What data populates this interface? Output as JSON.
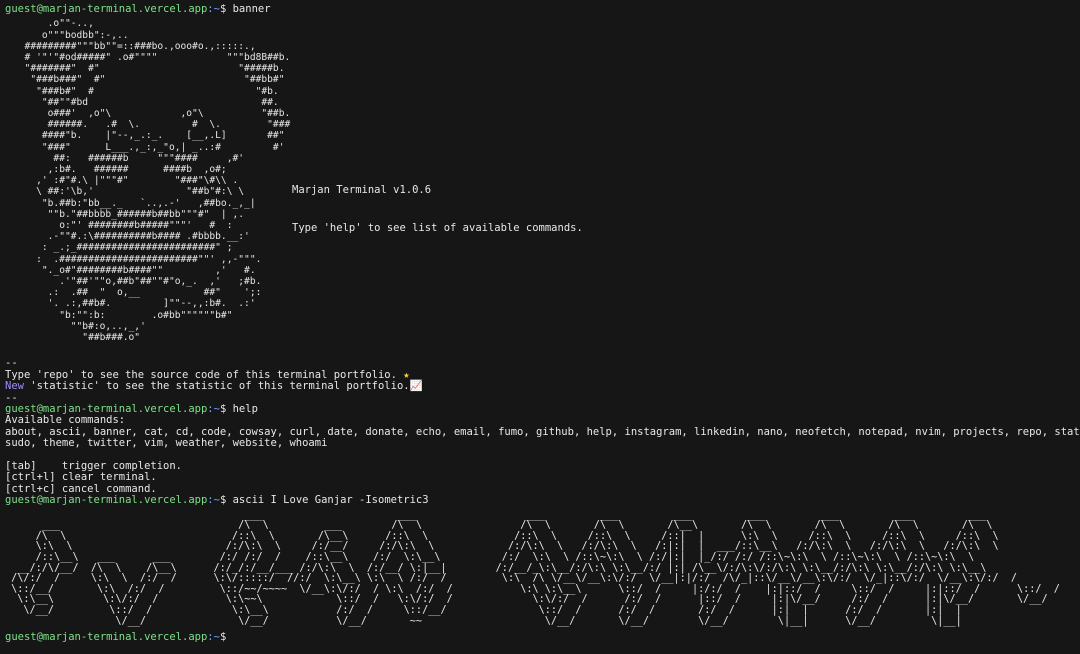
{
  "prompt": {
    "user_host": "guest@marjan-terminal.vercel.app",
    "path": ":~",
    "symbol": "$"
  },
  "commands": {
    "banner": "banner",
    "help": "help",
    "ascii": "ascii I Love Ganjar -Isometric3",
    "current": ""
  },
  "banner": {
    "ascii_art": "      .o\"\"-..,\n     o\"\"\"bodbb\":-,..\n  #########\"\"\"bb\"\"=::###bo.,ooo#o.,:::::.,\n  # '\"'\"#od#####\" .o#\"\"\"\"            \"\"\"bd8B##b.\n  \"#######\"  #\"                        \"#####b.\n   \"###b###\"  #\"                        \"##bb#\"\n    \"###b#\"  #                            \"#b.\n     \"##\"\"#bd                              ##.\n      o###'  ,o\"\\            ,o\"\\          \"##b.\n      ######.   .#  \\.         #  \\.        \"###\n     ####\"b.    |\"--,_.:_.    [__,.L]       ##\"\n     \"###\"      L___.,_:,_\"o,| _..:#         #'\n       ##:   ######b     \"\"\"####     ,#'\n      ,:b#.   ######      ####b  ,o#;\n    ,' :#\"#.\\ |\"\"\"#\"        \"###\"\\#\\\\ .\n    \\ ##:'\\b,'                \"##b\"#:\\ \\\n     \"b.##b:\"bb__._   `..,.-'   ,##bo._,_|\n      \"\"b.\"##bbbb_######b##bb\"\"\"#\"  | ,.\n        o:\"' ########b#####\"\"\"'   #  :\n      .-\"\"#.:\\##########b#### .#bbbb.__:'\n     : _.;_########################\" ;\n    :  .########################\"\"' ,,-\"\"\".\n     \"._o#\"########b####\"\"         ,'   #.\n        .'\"##'\"\"o,##b\"##\"\"#\"o,_.  ,'   ;#b.\n      .:  .##  \"  o,__           ##\"    ';:\n      '. .:,##b#.         ]\"\"--,,:b#.  .:'\n        \"b:\"\":b:        .o#bb\"\"\"\"\"\"b#\"\n          \"\"b#:o,..,_,'\n            \"##b###.o\"",
    "title": "Marjan Terminal v1.0.6",
    "hint": "Type 'help' to see list of available commands."
  },
  "messages": {
    "separator_top": "--",
    "repo_line": "Type 'repo' to see the source code of this terminal portfolio.",
    "repo_emoji": "★",
    "new_label": "New",
    "statistic_line": " 'statistic' to see the statistic of this terminal portfolio.",
    "statistic_emoji": "📈",
    "separator_bottom": "--"
  },
  "help": {
    "header": "Available commands:",
    "commands_line1": "about, ascii, banner, cat, cd, code, cowsay, curl, date, donate, echo, email, fumo, github, help, instagram, linkedin, nano, neofetch, notepad, nvim, projects, repo, statistic,",
    "commands_line2": "sudo, theme, twitter, vim, weather, website, whoami",
    "shortcut_tab": "[tab]    trigger completion.",
    "shortcut_clear": "[ctrl+l] clear terminal.",
    "shortcut_cancel": "[ctrl+c] cancel command."
  },
  "ascii_output": {
    "art": "                                       ___                      ___                  ___         ___         ___         ___         ___         ___         ___\n      ___                             /\\  \\         ___        /\\  \\                /\\  \\       /\\  \\       /\\__\\       /\\  \\       /\\  \\       /\\  \\       /\\  \\\n     /\\  \\                           /::\\  \\       /\\__\\      /::\\  \\              /::\\  \\     /::\\  \\     /::|  |      \\:\\  \\     /::\\  \\     /::\\  \\     /::\\  \\\n     \\:\\  \\                         /:/\\:\\  \\     /:/__/     /:/\\:\\  \\            /:/\\:\\  \\   /:/\\:\\  \\   /:|:|  |  ___/::\\__\\   /:/\\:\\  \\   /:/\\:\\  \\   /:/\\:\\  \\\n     /::\\__\\   ___      ___        /:/ /:/  /    /::\\__\\    /:/  \\:\\__\\          /:/  \\:\\  \\ /::\\~\\:\\  \\ /:/|:|  |_/:/ /:/ /::\\~\\:\\  \\ /::\\~\\:\\  \\ /::\\~\\:\\  \\\n  __/:/\\/__/  /\\  \\    /\\__\\      /:/_/:/__/___ /:/\\:\\  \\  /:/__/ \\:|__|        /:/__/_\\:\\__/:/\\:\\ \\:\\__/:/ |:| /\\__\\/:/\\:\\/:/\\:\\ \\:\\__/:/\\:\\ \\:\\__/:/\\:\\ \\:\\__\\\n /\\/:/  /     \\:\\  \\  /:/  /      \\:\\/:::::/  //:/  \\:\\__\\ \\:\\  \\ /:/  /         \\:\\  /\\ \\/__\\/__\\:\\/:/  \\/__|:|/:/  /\\/_|::\\/__\\/__\\:\\/:/  \\/_|::\\/:/  \\/__\\:\\/:/  /\n \\::/__/       \\:\\  /:/  /         \\::/~~/~~~~  \\/__\\:\\/:/  / \\:\\  /:/  /           \\:\\ \\:\\__\\      \\::/  /     |:/:/  /    |:|::/  /     \\::/  /     |:|::/  /      \\::/  /\n  \\:\\__\\        \\:\\/:/  /           \\:\\~~\\            \\::/  /   \\:\\/:/  /             \\:\\/:/  /      /:/  /      |::/  /     |:|\\/__/     /:/  /      |:|\\/__/       \\/__/\n   \\/__/         \\::/  /             \\:\\__\\           /:/  /     \\::/__/               \\::/  /      /:/  /       /:/  /      |:|  |      /:/  /       |:|  |\n                  \\/__/               \\/__/           \\/__/       ~~                    \\/__/       \\/__/        \\/__/        \\|__|      \\/__/         \\|__|"
  }
}
